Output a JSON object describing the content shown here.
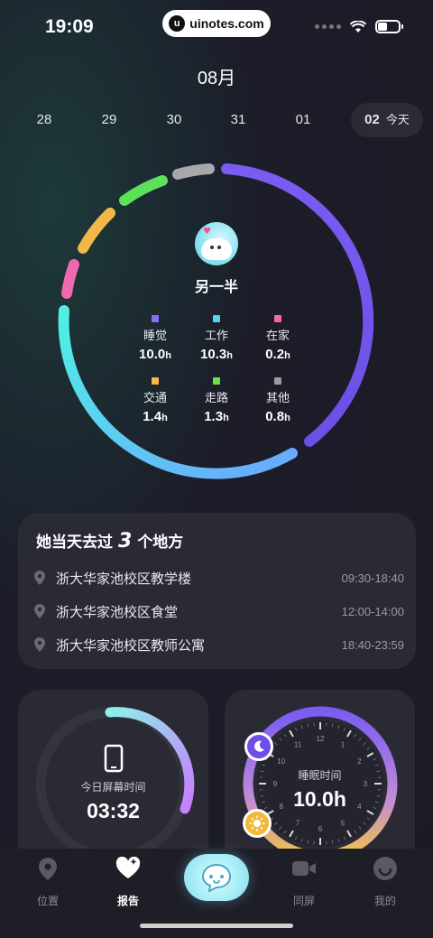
{
  "status_bar": {
    "time": "19:09",
    "watermark": "uinotes.com"
  },
  "date_strip": {
    "month": "08月",
    "days": [
      "28",
      "29",
      "30",
      "31",
      "01"
    ],
    "today": {
      "day": "02",
      "label": "今天"
    }
  },
  "activity": {
    "partner_name": "另一半",
    "unit": "h",
    "categories": [
      {
        "label": "睡觉",
        "value": "10.0",
        "color": "#7b5cf0"
      },
      {
        "label": "工作",
        "value": "10.3",
        "color": "#4fd6e8"
      },
      {
        "label": "在家",
        "value": "0.2",
        "color": "#f06aa8"
      },
      {
        "label": "交通",
        "value": "1.4",
        "color": "#f5b94e"
      },
      {
        "label": "走路",
        "value": "1.3",
        "color": "#6fe04a"
      },
      {
        "label": "其他",
        "value": "0.8",
        "color": "#9a9aa0"
      }
    ]
  },
  "places": {
    "title_prefix": "她当天去过",
    "count": "3",
    "title_suffix": "个地方",
    "items": [
      {
        "name": "浙大华家池校区教学楼",
        "range": "09:30-18:40"
      },
      {
        "name": "浙大华家池校区食堂",
        "range": "12:00-14:00"
      },
      {
        "name": "浙大华家池校区教师公寓",
        "range": "18:40-23:59"
      }
    ]
  },
  "screen_time": {
    "label": "今日屏幕时间",
    "value": "03:32"
  },
  "sleep": {
    "label": "睡眠时间",
    "value": "10.0h",
    "clock_numbers": [
      "12",
      "1",
      "2",
      "3",
      "4",
      "5",
      "6",
      "7",
      "8",
      "9",
      "10",
      "11"
    ]
  },
  "tabbar": {
    "items": [
      {
        "label": "位置",
        "icon": "location-pin-icon"
      },
      {
        "label": "报告",
        "icon": "heart-sparkle-icon"
      },
      {
        "label": "同屏",
        "icon": "video-camera-icon"
      },
      {
        "label": "我的",
        "icon": "smiley-face-icon"
      }
    ],
    "center": {
      "icon": "chat-bubble-icon"
    }
  }
}
